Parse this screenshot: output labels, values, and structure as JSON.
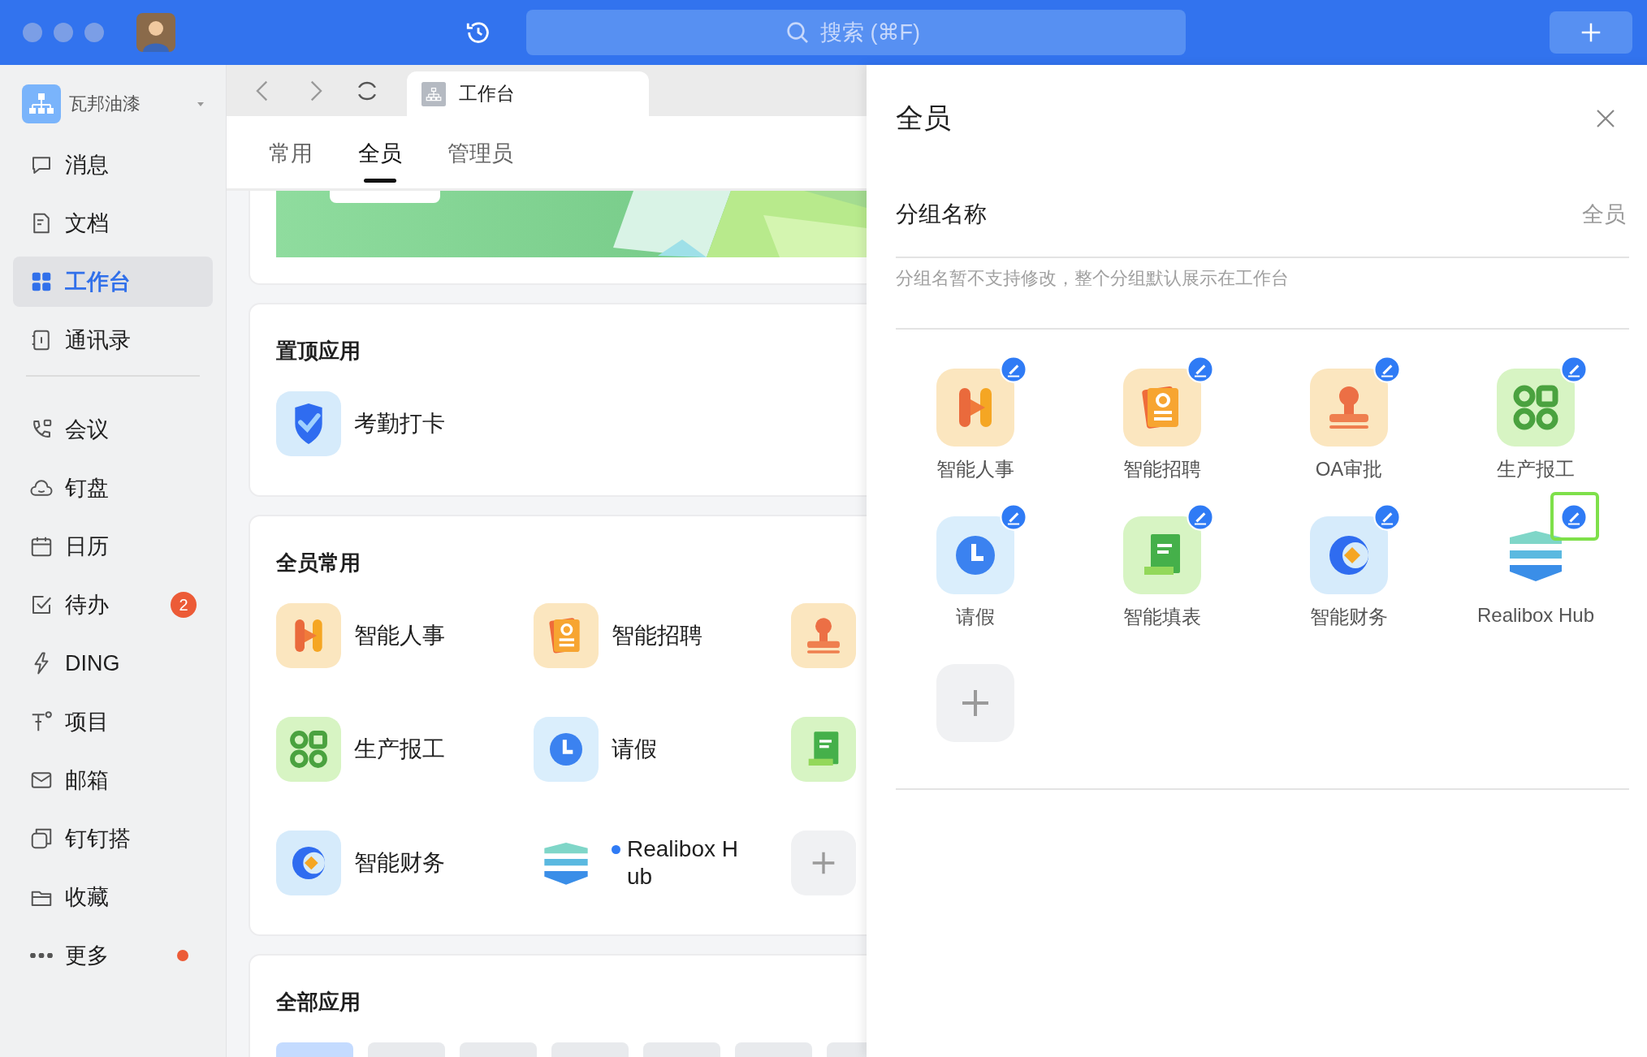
{
  "title_bar": {
    "search": {
      "placeholder": "搜索 (⌘F)"
    }
  },
  "sidebar": {
    "org": {
      "name": "瓦邦油漆"
    },
    "groups": [
      {
        "items": [
          {
            "label": "消息",
            "kind": "message",
            "selected": false,
            "dot": false
          },
          {
            "label": "文档",
            "kind": "doc",
            "selected": false,
            "dot": false
          },
          {
            "label": "工作台",
            "kind": "workbench",
            "selected": true,
            "dot": false
          },
          {
            "label": "通讯录",
            "kind": "contacts",
            "selected": false,
            "dot": false
          }
        ]
      },
      {
        "items": [
          {
            "label": "会议",
            "kind": "meeting",
            "selected": false,
            "dot": false
          },
          {
            "label": "钉盘",
            "kind": "drive",
            "selected": false,
            "dot": false
          },
          {
            "label": "日历",
            "kind": "calendar",
            "selected": false,
            "dot": false
          },
          {
            "label": "待办",
            "kind": "todo",
            "selected": false,
            "badge": "2",
            "dot": false
          },
          {
            "label": "DING",
            "kind": "ding",
            "selected": false,
            "dot": false
          },
          {
            "label": "项目",
            "kind": "project",
            "selected": false,
            "dot": false
          },
          {
            "label": "邮箱",
            "kind": "mail",
            "selected": false,
            "dot": false
          },
          {
            "label": "钉钉搭",
            "kind": "builder",
            "selected": false,
            "dot": false
          },
          {
            "label": "收藏",
            "kind": "favorites",
            "selected": false,
            "dot": false
          },
          {
            "label": "更多",
            "kind": "more",
            "selected": false,
            "dot": true
          }
        ]
      }
    ]
  },
  "browser_tab": {
    "title": "工作台"
  },
  "tabs": [
    {
      "label": "常用",
      "selected": false
    },
    {
      "label": "全员",
      "selected": true
    },
    {
      "label": "管理员",
      "selected": false
    }
  ],
  "cards": [
    {
      "kind": "banner"
    },
    {
      "kind": "apps",
      "title": "置顶应用",
      "apps": [
        {
          "label": "考勤打卡",
          "kind": "checkin",
          "new": false
        }
      ]
    },
    {
      "kind": "apps",
      "title": "全员常用",
      "apps": [
        {
          "label": "智能人事",
          "kind": "hr",
          "new": false
        },
        {
          "label": "智能招聘",
          "kind": "recruit",
          "new": false
        },
        {
          "kind": "stamp",
          "new": false
        },
        {
          "label": "生产报工",
          "kind": "production",
          "new": false
        },
        {
          "label": "请假",
          "kind": "leave",
          "new": false
        },
        {
          "kind": "form",
          "new": false
        },
        {
          "label": "智能财务",
          "kind": "finance",
          "new": false
        },
        {
          "label": "Realibox Hub",
          "kind": "realibox",
          "new": true
        },
        {
          "kind": "add",
          "new": false
        }
      ]
    },
    {
      "kind": "categories",
      "title": "全部应用",
      "chips": [
        {
          "selected": true
        },
        {
          "selected": false
        },
        {
          "selected": false
        },
        {
          "selected": false
        },
        {
          "selected": false
        },
        {
          "selected": false
        },
        {
          "selected": false
        }
      ]
    }
  ],
  "drawer": {
    "title": "全员",
    "field": {
      "label": "分组名称",
      "value": "全员"
    },
    "hint": "分组名暂不支持修改，整个分组默认展示在工作台",
    "apps": [
      {
        "label": "智能人事",
        "kind": "hr",
        "editable": true,
        "highlighted": false
      },
      {
        "label": "智能招聘",
        "kind": "recruit",
        "editable": true,
        "highlighted": false
      },
      {
        "label": "OA审批",
        "kind": "stamp",
        "editable": true,
        "highlighted": false
      },
      {
        "label": "生产报工",
        "kind": "production",
        "editable": true,
        "highlighted": false
      },
      {
        "label": "请假",
        "kind": "leave",
        "editable": true,
        "highlighted": false
      },
      {
        "label": "智能填表",
        "kind": "form",
        "editable": true,
        "highlighted": false
      },
      {
        "label": "智能财务",
        "kind": "finance",
        "editable": true,
        "highlighted": false
      },
      {
        "label": "Realibox Hub",
        "kind": "realibox",
        "editable": true,
        "highlighted": true
      },
      {
        "kind": "add",
        "editable": false,
        "highlighted": false
      }
    ]
  }
}
